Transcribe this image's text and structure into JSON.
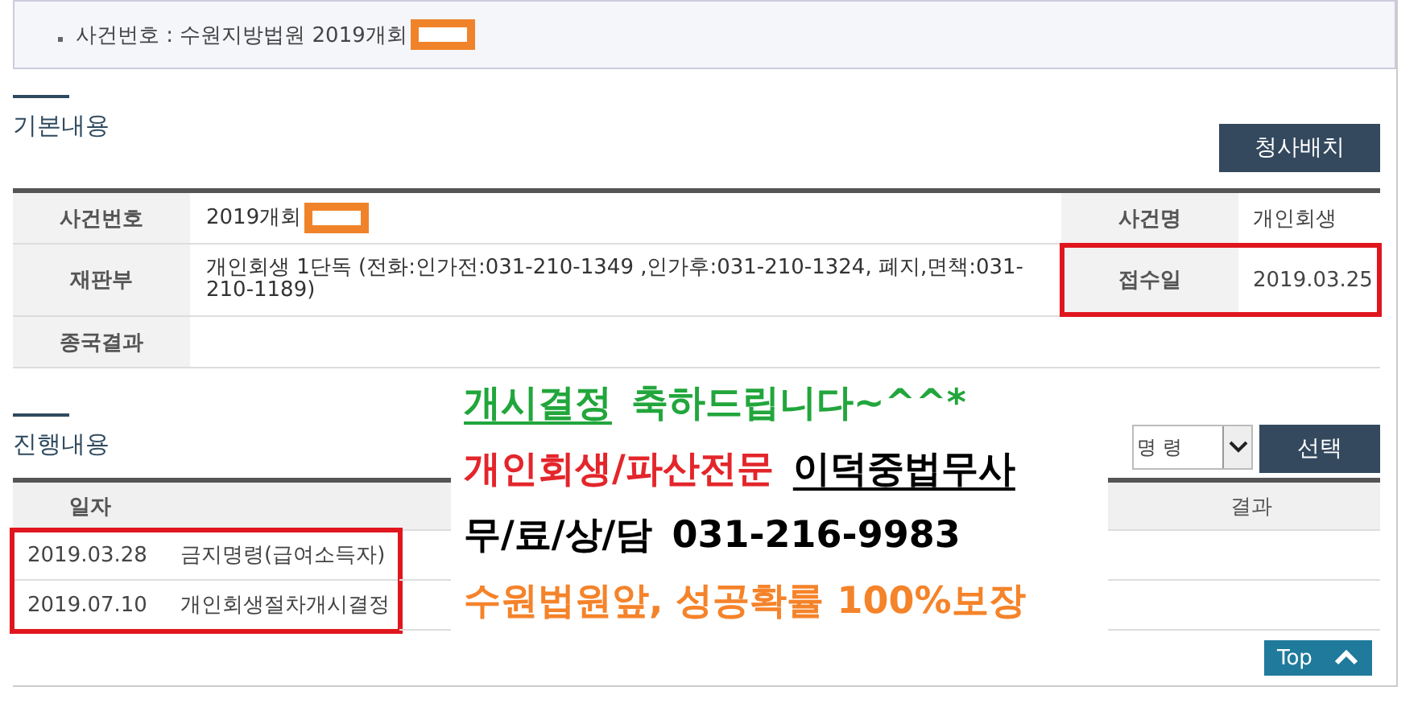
{
  "breadcrumb": {
    "label": "사건번호 : 수원지방법원 2019개회",
    "redacted": true
  },
  "basic": {
    "title": "기본내용",
    "button": "청사배치",
    "rows": [
      {
        "label": "사건번호",
        "value": "2019개회",
        "redacted": true,
        "label2": "사건명",
        "value2": "개인회생"
      },
      {
        "label": "재판부",
        "value": "개인회생 1단독 (전화:인가전:031-210-1349 ,인가후:031-210-1324, 폐지,면책:031-210-1189)",
        "label2": "접수일",
        "value2": "2019.03.25",
        "highlighted": true
      },
      {
        "label": "종국결과"
      }
    ]
  },
  "progress": {
    "title": "진행내용",
    "select": {
      "value": "명 령"
    },
    "button": "선택",
    "columns": [
      "일자",
      "결과"
    ],
    "highlighted": true,
    "rows": [
      {
        "date": "2019.03.28",
        "content": "금지명령(급여소득자)"
      },
      {
        "date": "2019.07.10",
        "content": "개인회생절차개시결정"
      }
    ]
  },
  "ad": {
    "lines": [
      {
        "segments": [
          {
            "text": "개시결정",
            "color": "#22a63c",
            "underlined": true
          },
          {
            "text": "축하드립니다~^^*",
            "color": "#22a63c",
            "underlined": false
          }
        ]
      },
      {
        "segments": [
          {
            "text": "개인회생/파산전문",
            "color": "#e3262b",
            "underlined": false
          },
          {
            "text": "이덕중법무사",
            "color": "#000000",
            "underlined": true
          }
        ]
      },
      {
        "segments": [
          {
            "text": "무/료/상/담",
            "color": "#000000",
            "underlined": false
          },
          {
            "text": "031-216-9983",
            "color": "#000000",
            "underlined": false
          }
        ]
      },
      {
        "segments": [
          {
            "text": "수원법원앞, 성공확률 100%보장",
            "color": "#f5832a",
            "underlined": false
          }
        ]
      }
    ]
  },
  "top_button": "Top"
}
